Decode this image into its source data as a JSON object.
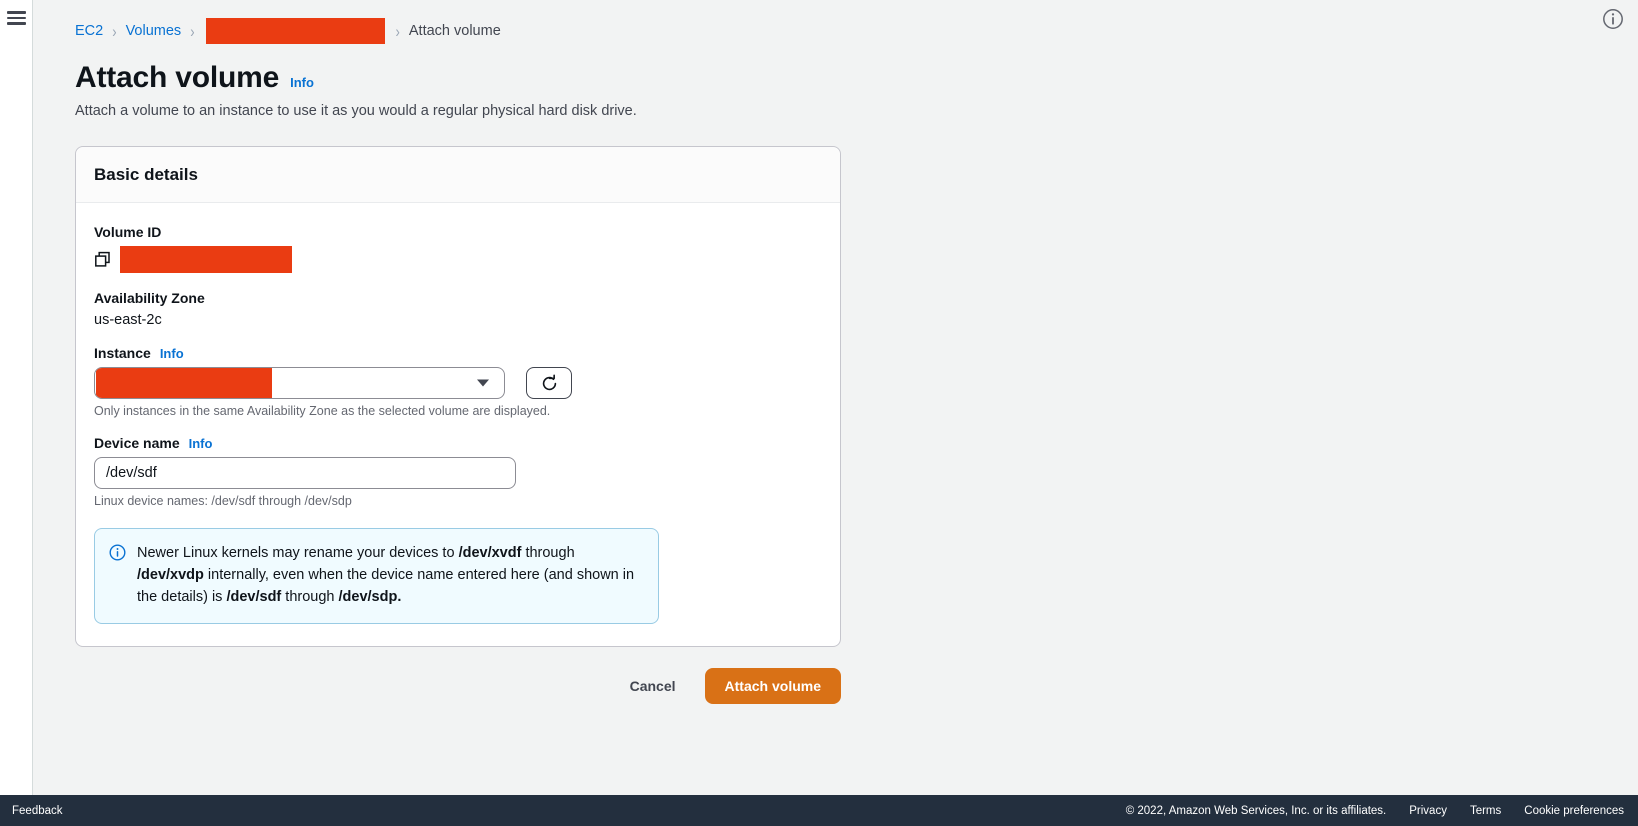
{
  "breadcrumb": {
    "items": [
      {
        "label": "EC2",
        "type": "link"
      },
      {
        "label": "Volumes",
        "type": "link"
      },
      {
        "label": "",
        "type": "redacted"
      },
      {
        "label": "Attach volume",
        "type": "current"
      }
    ],
    "separator": "›"
  },
  "page": {
    "title": "Attach volume",
    "info_label": "Info",
    "description": "Attach a volume to an instance to use it as you would a regular physical hard disk drive."
  },
  "card": {
    "title": "Basic details",
    "volume_id": {
      "label": "Volume ID",
      "value": "",
      "copy_icon": "copy-icon"
    },
    "availability_zone": {
      "label": "Availability Zone",
      "value": "us-east-2c"
    },
    "instance": {
      "label": "Instance",
      "info_label": "Info",
      "selected_value": "",
      "hint": "Only instances in the same Availability Zone as the selected volume are displayed.",
      "refresh_icon": "refresh-icon",
      "caret_icon": "chevron-down-icon"
    },
    "device_name": {
      "label": "Device name",
      "info_label": "Info",
      "value": "/dev/sdf",
      "placeholder": "/dev/sdf",
      "hint": "Linux device names: /dev/sdf through /dev/sdp"
    },
    "alert": {
      "icon": "info-circle-icon",
      "segments": [
        {
          "text": "Newer Linux kernels may rename your devices to ",
          "bold": false
        },
        {
          "text": "/dev/xvdf",
          "bold": true
        },
        {
          "text": " through ",
          "bold": false
        },
        {
          "text": "/dev/xvdp",
          "bold": true
        },
        {
          "text": " internally, even when the device name entered here (and shown in the details) is ",
          "bold": false
        },
        {
          "text": "/dev/sdf",
          "bold": true
        },
        {
          "text": " through ",
          "bold": false
        },
        {
          "text": "/dev/sdp.",
          "bold": true
        }
      ]
    }
  },
  "actions": {
    "cancel_label": "Cancel",
    "submit_label": "Attach volume"
  },
  "footer": {
    "feedback_label": "Feedback",
    "copyright": "© 2022, Amazon Web Services, Inc. or its affiliates.",
    "links": [
      {
        "label": "Privacy"
      },
      {
        "label": "Terms"
      },
      {
        "label": "Cookie preferences"
      }
    ]
  },
  "chrome": {
    "menu_icon": "hamburger-menu-icon",
    "info_corner_icon": "info-circle-icon"
  },
  "colors": {
    "redaction": "#ea3c12",
    "link": "#0972d3",
    "primary_button": "#d97116",
    "footer_background": "#232f3e",
    "page_background": "#f2f3f3"
  }
}
